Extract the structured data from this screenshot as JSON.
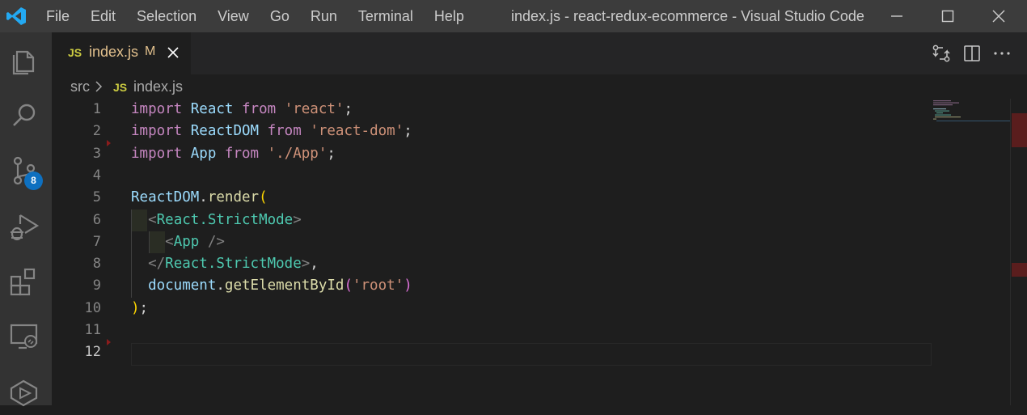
{
  "titlebar": {
    "menu": [
      "File",
      "Edit",
      "Selection",
      "View",
      "Go",
      "Run",
      "Terminal",
      "Help"
    ],
    "window_title": "index.js - react-redux-ecommerce - Visual Studio Code"
  },
  "activity_bar": {
    "items": [
      "explorer-icon",
      "search-icon",
      "source-control-icon",
      "run-debug-icon",
      "extensions-icon",
      "remote-explorer-icon",
      "live-share-icon"
    ],
    "source_control_badge": "8"
  },
  "tab": {
    "icon_label": "JS",
    "name": "index.js",
    "modified_indicator": "M"
  },
  "breadcrumb": {
    "folder": "src",
    "file_icon_label": "JS",
    "file": "index.js"
  },
  "editor": {
    "line_numbers": [
      "1",
      "2",
      "3",
      "4",
      "5",
      "6",
      "7",
      "8",
      "9",
      "10",
      "11",
      "12"
    ],
    "current_line": "12",
    "code_lines": [
      "import React from 'react';",
      "import ReactDOM from 'react-dom';",
      "import App from './App';",
      "",
      "ReactDOM.render(",
      "  <React.StrictMode>",
      "    <App />",
      "  </React.StrictMode>,",
      "  document.getElementById('root')",
      ");",
      "",
      ""
    ]
  },
  "colors": {
    "keyword": "#c586c0",
    "variable": "#9cdcfe",
    "string": "#ce9178",
    "function": "#dcdcaa",
    "jsx_tag": "#4ec9b0",
    "badge": "#0e70c0",
    "modified": "#e2c08d"
  }
}
